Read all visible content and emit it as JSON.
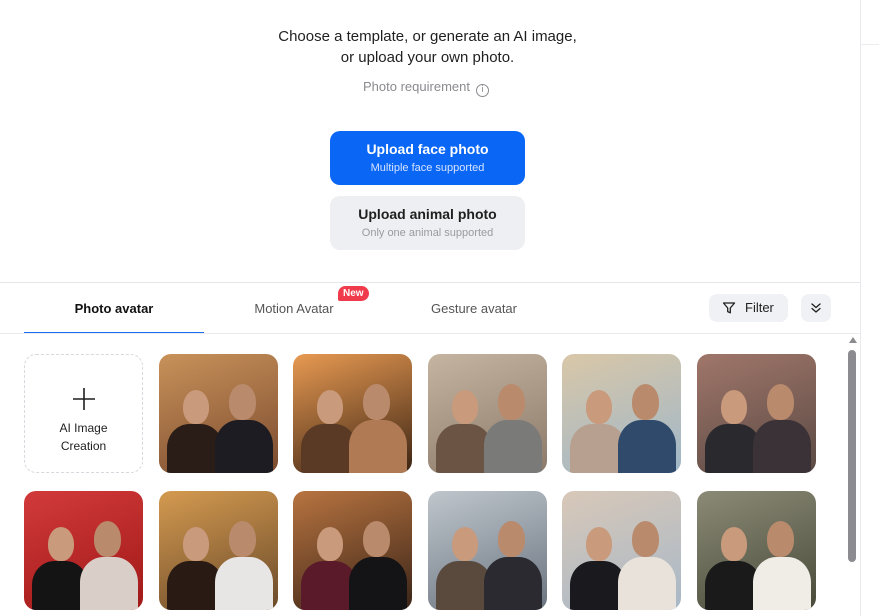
{
  "intro": {
    "line1": "Choose a template, or generate an AI image,",
    "line2": "or upload your own photo.",
    "requirement": "Photo requirement",
    "requirement_icon": "info-icon"
  },
  "upload_face": {
    "title": "Upload face photo",
    "subtitle": "Multiple face supported"
  },
  "upload_animal": {
    "title": "Upload animal photo",
    "subtitle": "Only one animal supported"
  },
  "tabs": [
    {
      "label": "Photo avatar",
      "active": true
    },
    {
      "label": "Motion Avatar",
      "badge": "New"
    },
    {
      "label": "Gesture avatar"
    }
  ],
  "toolbar": {
    "filter_label": "Filter",
    "filter_icon": "funnel-icon",
    "collapse_icon": "double-chevron-down-icon"
  },
  "ai_card": {
    "line1": "AI Image",
    "line2": "Creation",
    "icon": "plus-icon"
  },
  "colors": {
    "accent": "#0a66f5",
    "badge": "#ef3b4b"
  },
  "templates": [
    {
      "name": "paris-night-couple",
      "bg": "#7a4a2e",
      "bg2": "#c9925a",
      "p1": "#2a1d17",
      "p2": "#1c1c22"
    },
    {
      "name": "sunset-selfie-couple",
      "bg": "#3b2414",
      "bg2": "#e89a52",
      "p1": "#5a3a25",
      "p2": "#b07a55"
    },
    {
      "name": "street-couple",
      "bg": "#8c7a6a",
      "bg2": "#c4b4a0",
      "p1": "#6b5444",
      "p2": "#7a7a78"
    },
    {
      "name": "balloon-couple",
      "bg": "#9fb7c9",
      "bg2": "#d9c7a8",
      "p1": "#b8a090",
      "p2": "#2f4a6a"
    },
    {
      "name": "city-sign-couple",
      "bg": "#5a4a44",
      "bg2": "#a0766a",
      "p1": "#2a2a2e",
      "p2": "#3a3236"
    },
    {
      "name": "red-carpet-couple",
      "bg": "#a01818",
      "bg2": "#d23a3a",
      "p1": "#141414",
      "p2": "#d9cfc8"
    },
    {
      "name": "bokeh-couple",
      "bg": "#6a4a2a",
      "bg2": "#d49a50",
      "p1": "#2a1a14",
      "p2": "#e8e6e4"
    },
    {
      "name": "night-glam-couple",
      "bg": "#3a2418",
      "bg2": "#b87440",
      "p1": "#5a1a2a",
      "p2": "#141416"
    },
    {
      "name": "snow-couple",
      "bg": "#6a7480",
      "bg2": "#bfc6cc",
      "p1": "#5a4a3e",
      "p2": "#2a2a30"
    },
    {
      "name": "beach-couple",
      "bg": "#a8b8c8",
      "bg2": "#d8c8b8",
      "p1": "#1a1a1e",
      "p2": "#e8e2da"
    },
    {
      "name": "wedding-couple",
      "bg": "#4a4a3a",
      "bg2": "#8a8a76",
      "p1": "#1a1a1a",
      "p2": "#f0ece6"
    }
  ]
}
